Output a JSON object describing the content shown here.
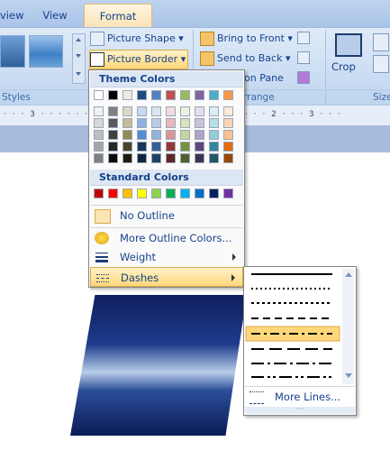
{
  "tabs": {
    "view_left": "view",
    "view": "View",
    "format": "Format"
  },
  "ribbon": {
    "picture_shape": "Picture Shape",
    "picture_border": "Picture Border",
    "bring_to_front": "Bring to Front",
    "send_to_back": "Send to Back",
    "selection_pane": "ion Pane",
    "crop": "Crop",
    "styles_label": "Styles",
    "arrange_label": "rrange",
    "size_label": "Size"
  },
  "menu": {
    "theme_colors_header": "Theme Colors",
    "standard_colors_header": "Standard Colors",
    "no_outline": "No Outline",
    "more_outline_colors": "More Outline Colors...",
    "weight": "Weight",
    "dashes": "Dashes",
    "theme_top": [
      "#ffffff",
      "#000000",
      "#eeece1",
      "#1f497d",
      "#4f81bd",
      "#c0504d",
      "#9bbb59",
      "#8064a2",
      "#4bacc6",
      "#f79646"
    ],
    "theme_shades": [
      [
        "#f2f2f2",
        "#7f7f7f",
        "#ddd9c3",
        "#c6d9f0",
        "#dbe5f1",
        "#f2dcdb",
        "#ebf1dd",
        "#e5e0ec",
        "#dbeef3",
        "#fdeada"
      ],
      [
        "#d8d8d8",
        "#595959",
        "#c4bd97",
        "#8db3e2",
        "#b8cce4",
        "#e5b9b7",
        "#d7e3bc",
        "#ccc1d9",
        "#b7dde8",
        "#fbd5b5"
      ],
      [
        "#bfbfbf",
        "#3f3f3f",
        "#938953",
        "#548dd4",
        "#95b3d7",
        "#d99694",
        "#c3d69b",
        "#b2a2c7",
        "#92cddc",
        "#fac08f"
      ],
      [
        "#a5a5a5",
        "#262626",
        "#494429",
        "#17365d",
        "#366092",
        "#953734",
        "#76923c",
        "#5f497a",
        "#31859b",
        "#e36c09"
      ],
      [
        "#7f7f7f",
        "#0c0c0c",
        "#1d1b10",
        "#0f243e",
        "#244061",
        "#632423",
        "#4f6128",
        "#3f3151",
        "#205867",
        "#974806"
      ]
    ],
    "standard": [
      "#c00000",
      "#ff0000",
      "#ffc000",
      "#ffff00",
      "#92d050",
      "#00b050",
      "#00b0f0",
      "#0070c0",
      "#002060",
      "#7030a0"
    ]
  },
  "submenu": {
    "more_lines": "More Lines...",
    "dash_styles": [
      "solid",
      "round-dot",
      "square-dot",
      "dash",
      "dash-dot",
      "long-dash",
      "long-dash-dot",
      "long-dash-dot-dot"
    ],
    "selected_style": "long-dash"
  }
}
